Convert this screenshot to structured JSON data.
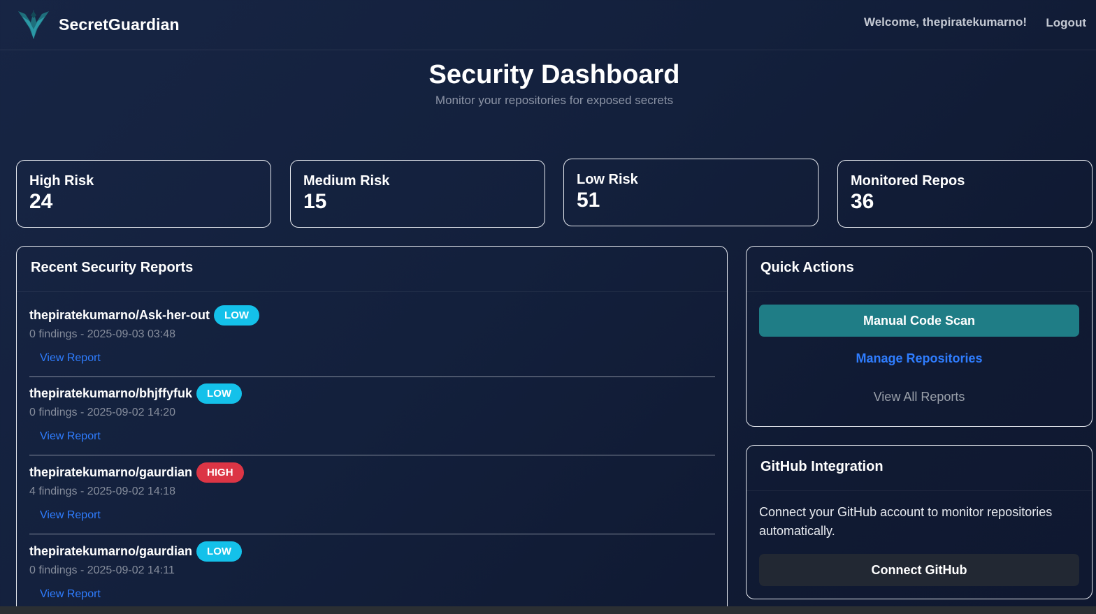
{
  "app": {
    "brand_name": "SecretGuardian",
    "welcome_text": "Welcome, thepiratekumarno!",
    "logout_label": "Logout"
  },
  "header": {
    "title": "Security Dashboard",
    "subtitle": "Monitor your repositories for exposed secrets"
  },
  "stats": [
    {
      "label": "High Risk",
      "value": "24"
    },
    {
      "label": "Medium Risk",
      "value": "15"
    },
    {
      "label": "Low Risk",
      "value": "51"
    },
    {
      "label": "Monitored Repos",
      "value": "36"
    }
  ],
  "reports": {
    "title": "Recent Security Reports",
    "view_label": "View Report",
    "items": [
      {
        "repo": "thepiratekumarno/Ask-her-out",
        "badge": "LOW",
        "meta": "0 findings - 2025-09-03 03:48"
      },
      {
        "repo": "thepiratekumarno/bhjffyfuk",
        "badge": "LOW",
        "meta": "0 findings - 2025-09-02 14:20"
      },
      {
        "repo": "thepiratekumarno/gaurdian",
        "badge": "HIGH",
        "meta": "4 findings - 2025-09-02 14:18"
      },
      {
        "repo": "thepiratekumarno/gaurdian",
        "badge": "LOW",
        "meta": "0 findings - 2025-09-02 14:11"
      }
    ]
  },
  "quick_actions": {
    "title": "Quick Actions",
    "scan_label": "Manual Code Scan",
    "manage_label": "Manage Repositories",
    "all_reports_label": "View All Reports"
  },
  "github": {
    "title": "GitHub Integration",
    "description": "Connect your GitHub account to monitor repositories automatically.",
    "connect_label": "Connect GitHub"
  },
  "colors": {
    "accent_teal": "#1f7d86",
    "link_blue": "#2f7dff",
    "badge_low": "#14c1ea",
    "badge_high": "#dc3545"
  }
}
